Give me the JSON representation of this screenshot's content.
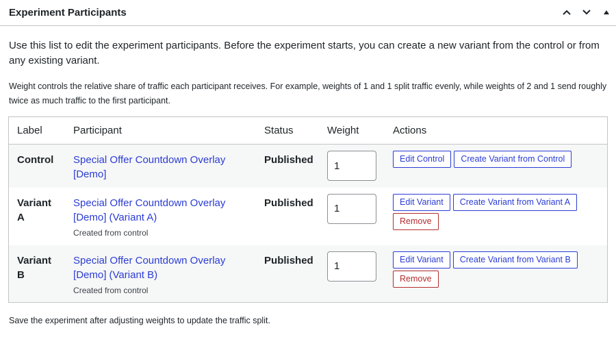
{
  "panel": {
    "title": "Experiment Participants"
  },
  "intro": "Use this list to edit the experiment participants. Before the experiment starts, you can create a new variant from the control or from any existing variant.",
  "weight_note": "Weight controls the relative share of traffic each participant receives. For example, weights of 1 and 1 split traffic evenly, while weights of 2 and 1 send roughly twice as much traffic to the first participant.",
  "table": {
    "headers": [
      "Label",
      "Participant",
      "Status",
      "Weight",
      "Actions"
    ],
    "rows": [
      {
        "label": "Control",
        "participant": "Special Offer Countdown Overlay [Demo]",
        "note": "",
        "status": "Published",
        "weight": "1",
        "edit": "Edit Control",
        "create": "Create Variant from Control",
        "remove": ""
      },
      {
        "label": "Variant A",
        "participant": "Special Offer Countdown Overlay [Demo] (Variant A)",
        "note": "Created from control",
        "status": "Published",
        "weight": "1",
        "edit": "Edit Variant",
        "create": "Create Variant from Variant A",
        "remove": "Remove"
      },
      {
        "label": "Variant B",
        "participant": "Special Offer Countdown Overlay [Demo] (Variant B)",
        "note": "Created from control",
        "status": "Published",
        "weight": "1",
        "edit": "Edit Variant",
        "create": "Create Variant from Variant B",
        "remove": "Remove"
      }
    ]
  },
  "footer_note": "Save the experiment after adjusting weights to update the traffic split.",
  "icons": {
    "move_up": "chevron-up-icon",
    "move_down": "chevron-down-icon",
    "toggle": "triangle-up-icon"
  },
  "colors": {
    "link": "#2b3cd4",
    "danger": "#b32d2e",
    "row_alt": "#f6f7f7",
    "border": "#c3c4c7"
  }
}
